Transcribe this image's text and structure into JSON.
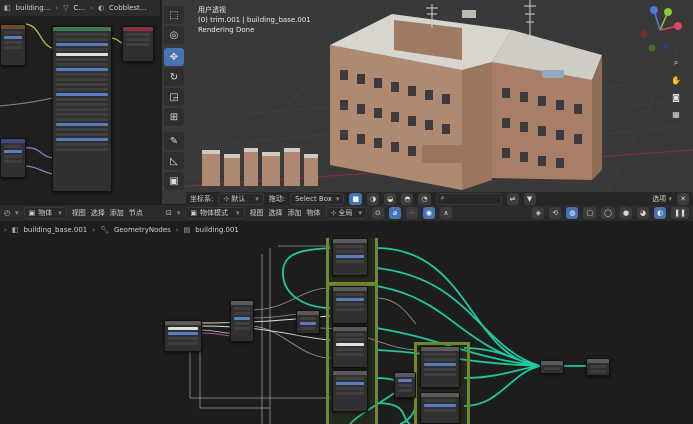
{
  "top_left_header": {
    "crumb1": "building...",
    "crumb2": "C...",
    "crumb3": "Cobblest..."
  },
  "viewport": {
    "overlay_line1": "用户透视",
    "overlay_line2": "(0) trim.001 | building_base.001",
    "overlay_line3": "Rendering Done",
    "footer": {
      "coord_label": "坐标系:",
      "coord_value": "默认",
      "drag_label": "拖动:",
      "drag_value": "Select Box",
      "options": "选项"
    }
  },
  "node_editor_left_header": {
    "object": "物体",
    "menu": [
      "视图",
      "选择",
      "添加",
      "节点"
    ]
  },
  "viewport_header": {
    "mode": "物体模式",
    "menu": [
      "视图",
      "选择",
      "添加",
      "物体"
    ],
    "global": "全局"
  },
  "geometry_nodes_header": {
    "crumb1": "building_base.001",
    "crumb2": "GeometryNodes",
    "crumb3": "building.001"
  },
  "colors": {
    "accent": "#4772b3",
    "frame": "#6f8a2e",
    "wire": "#1ec8a0",
    "grid_x": "#8a3040",
    "grid_y": "#5f8a2a"
  }
}
